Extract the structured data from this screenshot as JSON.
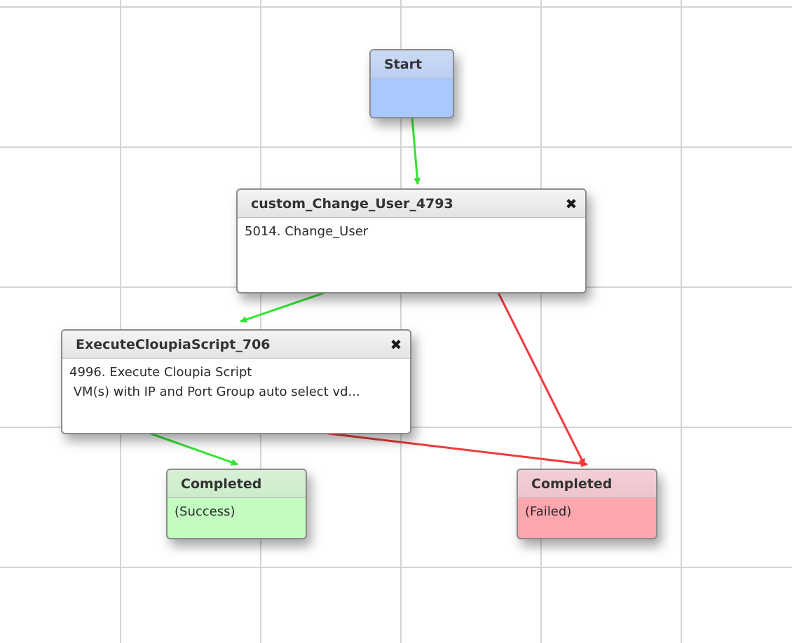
{
  "nodes": {
    "start": {
      "title": "Start"
    },
    "change_user": {
      "title": "custom_Change_User_4793",
      "close_symbol": "✖",
      "lines": [
        "5014. Change_User"
      ]
    },
    "execute_script": {
      "title": "ExecuteCloupiaScript_706",
      "close_symbol": "✖",
      "lines": [
        "4996. Execute Cloupia Script",
        " VM(s) with IP and Port Group auto select vd..."
      ]
    },
    "completed_success": {
      "title": "Completed",
      "status": "(Success)"
    },
    "completed_failed": {
      "title": "Completed",
      "status": "(Failed)"
    }
  },
  "connections": [
    {
      "from": "start",
      "to": "change_user",
      "outcome": "success"
    },
    {
      "from": "change_user",
      "to": "execute_script",
      "outcome": "success"
    },
    {
      "from": "change_user",
      "to": "completed_failed",
      "outcome": "failure"
    },
    {
      "from": "execute_script",
      "to": "completed_success",
      "outcome": "success"
    },
    {
      "from": "execute_script",
      "to": "completed_failed",
      "outcome": "failure"
    }
  ],
  "colors": {
    "success_connector": "#33e533",
    "failure_connector": "#f03a3a",
    "start_body": "#a9c8fd",
    "success_body": "#c2fdbf",
    "failed_body": "#fda6ae",
    "grid_line": "#d4d4d4"
  }
}
